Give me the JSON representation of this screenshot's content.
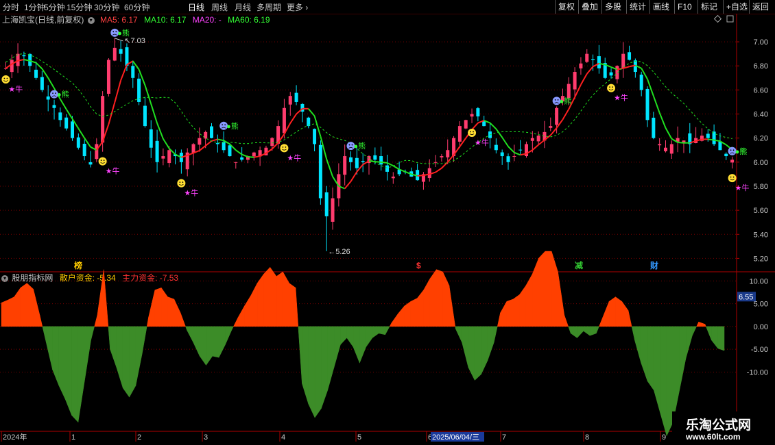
{
  "toolbar": {
    "tabs": [
      "分时",
      "1分钟",
      "5分钟",
      "15分钟",
      "30分钟",
      "60分钟",
      "日线",
      "周线",
      "月线",
      "多周期",
      "更多"
    ],
    "active_tab": "日线",
    "buttons": [
      "复权",
      "叠加",
      "多股",
      "统计",
      "画线",
      "F10",
      "标记",
      "+自选",
      "返回"
    ]
  },
  "main": {
    "title": "上海凯宝(日线,前复权)",
    "ma5": "MA5: 6.17",
    "ma10": "MA10: 6.17",
    "ma20": "MA20: -",
    "ma60": "MA60: 6.19"
  },
  "sub": {
    "title": "股朋指标网",
    "retail": "散户资金: -5.34",
    "main": "主力资金: -7.53",
    "current_value": "6.55"
  },
  "event_marks": [
    {
      "text": "榜",
      "color": "#ffcc00"
    },
    {
      "text": "$",
      "color": "#ff3333"
    },
    {
      "text": "减",
      "color": "#33cc33"
    },
    {
      "text": "财",
      "color": "#3399ff"
    }
  ],
  "xaxis": {
    "labels": [
      "2024年",
      "1",
      "2",
      "3",
      "4",
      "5",
      "6",
      "7",
      "8",
      "9"
    ],
    "cursor_date": "2025/06/04/三"
  },
  "watermark": {
    "line1": "乐淘公式网",
    "line2": "www.60lt.com"
  },
  "colors": {
    "up": "#ff3c6e",
    "down": "#00e5ff",
    "ma_up": "#ff2020",
    "ma_down": "#20e020",
    "ma_dash": "#20e020",
    "area_pos": "#ff4000",
    "area_neg": "#3c8c28",
    "grid": "#7a0000",
    "axis_text": "#cccccc",
    "bull": "#ff44ff",
    "bear": "#33ff33",
    "smile": "#ffdd33",
    "sad": "#8899ff"
  },
  "chart_data": [
    {
      "type": "candlestick",
      "title": "",
      "ylim": [
        5.1,
        7.12
      ],
      "yticks": [
        7.0,
        6.8,
        6.6,
        6.4,
        6.2,
        6.0,
        5.8,
        5.6,
        5.4,
        5.2
      ],
      "annotations": [
        {
          "text": "7.03",
          "note": "high"
        },
        {
          "text": "5.26",
          "note": "low"
        }
      ],
      "close_series": [
        6.78,
        6.85,
        6.9,
        6.88,
        6.8,
        6.7,
        6.6,
        6.52,
        6.45,
        6.35,
        6.28,
        6.2,
        6.12,
        6.05,
        5.98,
        6.15,
        6.55,
        6.85,
        6.95,
        6.9,
        6.8,
        6.7,
        6.5,
        6.3,
        6.12,
        6.0,
        6.05,
        6.1,
        6.05,
        6.0,
        6.08,
        6.15,
        6.2,
        6.25,
        6.2,
        6.15,
        6.1,
        6.05,
        6.0,
        6.02,
        6.05,
        6.08,
        6.1,
        6.12,
        6.2,
        6.3,
        6.45,
        6.55,
        6.5,
        6.42,
        6.3,
        6.15,
        5.7,
        5.55,
        5.7,
        5.9,
        6.05,
        6.0,
        5.95,
        6.0,
        6.05,
        6.02,
        5.98,
        5.92,
        5.88,
        5.9,
        5.92,
        5.88,
        5.85,
        5.9,
        5.95,
        6.0,
        6.05,
        6.1,
        6.2,
        6.3,
        6.35,
        6.4,
        6.38,
        6.3,
        6.2,
        6.1,
        6.05,
        6.0,
        6.05,
        6.1,
        6.15,
        6.2,
        6.22,
        6.25,
        6.3,
        6.45,
        6.55,
        6.65,
        6.75,
        6.82,
        6.9,
        6.85,
        6.78,
        6.7,
        6.72,
        6.8,
        6.9,
        6.85,
        6.75,
        6.6,
        6.35,
        6.2,
        6.15,
        6.12,
        6.15,
        6.2,
        6.18,
        6.15,
        6.2,
        6.22,
        6.2,
        6.15,
        6.1,
        6.05,
        6.02
      ],
      "events": [
        {
          "type": "smile",
          "label": "牛",
          "date_index": 0
        },
        {
          "type": "sad",
          "label": "熊",
          "date_index": 8
        },
        {
          "type": "smile",
          "label": "牛",
          "date_index": 16
        },
        {
          "type": "sad",
          "label": "熊",
          "date_index": 18
        },
        {
          "type": "smile",
          "label": "牛",
          "date_index": 29
        },
        {
          "type": "sad",
          "label": "熊",
          "date_index": 36
        },
        {
          "type": "smile",
          "label": "牛",
          "date_index": 46
        },
        {
          "type": "sad",
          "label": "熊",
          "date_index": 57
        },
        {
          "type": "smile",
          "label": "牛",
          "date_index": 77
        },
        {
          "type": "sad",
          "label": "熊",
          "date_index": 91
        },
        {
          "type": "smile",
          "label": "牛",
          "date_index": 100
        },
        {
          "type": "sad",
          "label": "熊",
          "date_index": 120
        },
        {
          "type": "smile",
          "label": "牛",
          "date_index": 122
        },
        {
          "type": "sad",
          "label": "熊",
          "date_index": 127
        }
      ]
    },
    {
      "type": "area",
      "title": "",
      "ylim": [
        -23,
        12
      ],
      "yticks": [
        10.0,
        5.0,
        0.0,
        -5.0,
        -10.0
      ],
      "series": [
        {
          "name": "散户资金",
          "values": [
            5.2,
            5.8,
            6.5,
            8.5,
            9.5,
            8.2,
            2.5,
            -3.5,
            -9.5,
            -13.0,
            -16.0,
            -19.5,
            -21.0,
            -12.0,
            -3.0,
            2.5,
            12.5,
            -5.0,
            -9.0,
            -13.5,
            -15.5,
            -13.0,
            -6.0,
            2.0,
            8.0,
            8.5,
            6.5,
            6.0,
            3.0,
            -0.8,
            -3.5,
            -6.5,
            -8.5,
            -6.5,
            -6.8,
            -4.0,
            -0.8,
            2.0,
            4.5,
            6.8,
            9.5,
            11.5,
            13.0,
            11.0,
            12.0,
            9.5,
            8.5,
            -12.5,
            -17.0,
            -20.0,
            -18.0,
            -14.0,
            -9.0,
            -4.0,
            -2.5,
            -4.5,
            -8.0,
            -4.5,
            -2.5,
            -1.5,
            -1.8,
            0.8,
            2.8,
            4.5,
            5.5,
            6.2,
            8.0,
            10.5,
            12.5,
            12.0,
            9.0,
            -0.5,
            -3.5,
            -9.0,
            -11.8,
            -10.5,
            -7.5,
            -3.5,
            3.0,
            5.5,
            6.0,
            7.0,
            9.0,
            11.5,
            15.0,
            16.5,
            16.5,
            12.0,
            2.5,
            -1.5,
            -2.5,
            -1.0,
            -2.0,
            -1.5,
            2.0,
            5.5,
            6.5,
            5.5,
            3.5,
            -3.0,
            -8.0,
            -12.0,
            -14.0,
            -19.0,
            -24.0,
            -21.0,
            -14.0,
            -7.0,
            -2.0,
            1.0,
            0.5,
            -3.0,
            -4.8,
            -5.3
          ]
        }
      ]
    }
  ]
}
